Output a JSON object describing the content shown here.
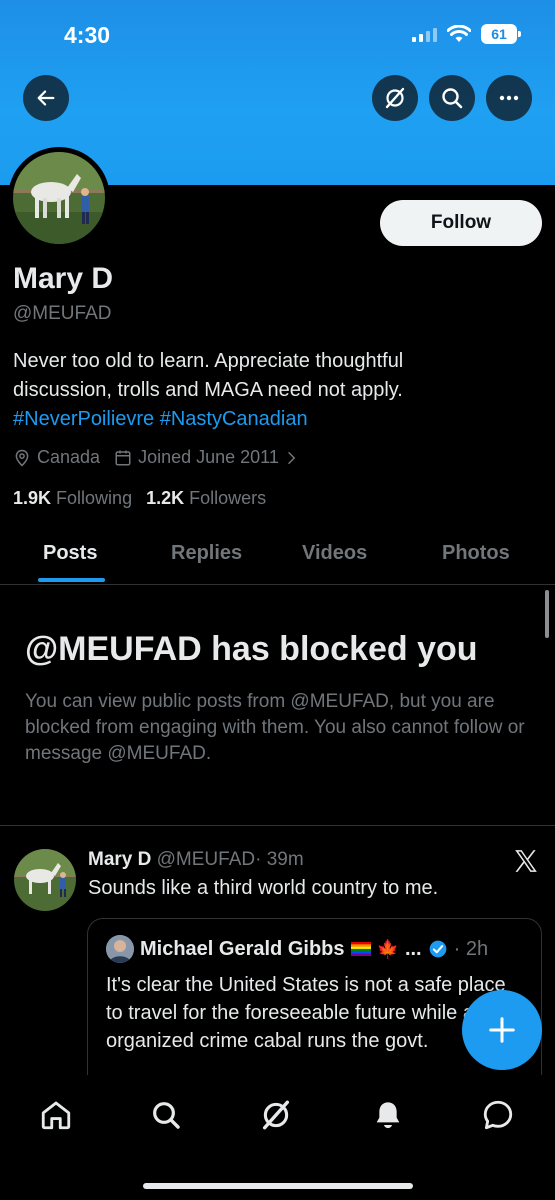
{
  "status_bar": {
    "time": "4:30",
    "battery": "61"
  },
  "profile": {
    "name": "Mary D",
    "handle": "@MEUFAD",
    "follow_label": "Follow",
    "bio_line1": "Never too old to learn. Appreciate thoughtful",
    "bio_line2": "discussion, trolls and MAGA need not apply.",
    "hashtag1": "#NeverPoilievre",
    "hashtag2": "#NastyCanadian",
    "location": "Canada",
    "joined": "Joined June 2011",
    "following_count": "1.9K",
    "following_label": "Following",
    "followers_count": "1.2K",
    "followers_label": "Followers"
  },
  "tabs": [
    {
      "label": "Posts"
    },
    {
      "label": "Replies"
    },
    {
      "label": "Videos"
    },
    {
      "label": "Photos"
    }
  ],
  "blocked": {
    "title": "@MEUFAD has blocked you",
    "message": "You can view public posts from @MEUFAD, but you are blocked from engaging with them. You also cannot follow or message @MEUFAD."
  },
  "post": {
    "author": "Mary D",
    "handle": "@MEUFAD",
    "time": "· 39m",
    "text": "Sounds like a third world country to me.",
    "quote": {
      "author": "Michael Gerald Gibbs",
      "emoji": "🍁",
      "ellipsis": "...",
      "time": "· 2h",
      "text": "It's clear the United States is not a safe place to travel for the foreseeable future while an organized crime cabal runs the govt."
    }
  },
  "colors": {
    "accent": "#1d9bf0",
    "background": "#000000",
    "banner": "#1d9bf0"
  }
}
